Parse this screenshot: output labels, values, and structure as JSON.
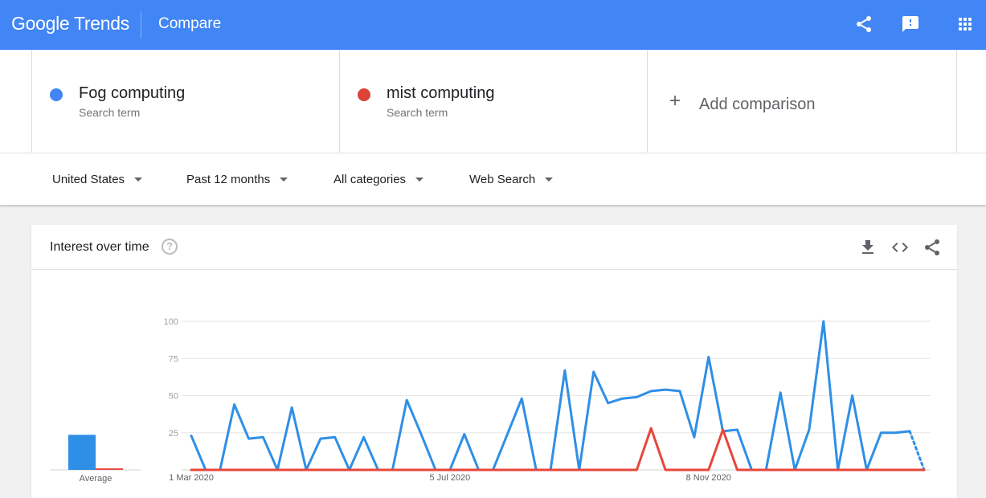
{
  "header": {
    "logo": "Google Trends",
    "page_label": "Compare",
    "icons": [
      "share-icon",
      "feedback-icon",
      "apps-icon"
    ]
  },
  "terms": [
    {
      "name": "Fog computing",
      "sub": "Search term",
      "color": "#4285f4"
    },
    {
      "name": "mist computing",
      "sub": "Search term",
      "color": "#db4437"
    }
  ],
  "add_comparison": {
    "label": "Add comparison"
  },
  "filters": {
    "region": "United States",
    "time": "Past 12 months",
    "category": "All categories",
    "property": "Web Search"
  },
  "card": {
    "title": "Interest over time",
    "help": "?",
    "icons": [
      "download-icon",
      "embed-icon",
      "share-icon"
    ]
  },
  "chart_data": {
    "type": "line",
    "ylim": [
      0,
      100
    ],
    "yticks": [
      "100",
      "75",
      "50",
      "25"
    ],
    "xtick_labels": [
      "1 Mar 2020",
      "5 Jul 2020",
      "8 Nov 2020"
    ],
    "xtick_index": [
      0,
      18,
      36
    ],
    "average_label": "Average",
    "averages": [
      23,
      1
    ],
    "series": [
      {
        "name": "Fog computing",
        "color": "#2f8fe6",
        "values": [
          23,
          0,
          0,
          44,
          21,
          22,
          0,
          42,
          0,
          21,
          22,
          0,
          22,
          0,
          0,
          47,
          24,
          0,
          0,
          24,
          0,
          0,
          24,
          48,
          0,
          0,
          67,
          0,
          66,
          45,
          48,
          49,
          53,
          54,
          53,
          22,
          76,
          26,
          27,
          0,
          0,
          52,
          0,
          27,
          100,
          0,
          50,
          0,
          25,
          25,
          26,
          0
        ],
        "partial_from": 50
      },
      {
        "name": "mist computing",
        "color": "#e8463b",
        "values": [
          0,
          0,
          0,
          0,
          0,
          0,
          0,
          0,
          0,
          0,
          0,
          0,
          0,
          0,
          0,
          0,
          0,
          0,
          0,
          0,
          0,
          0,
          0,
          0,
          0,
          0,
          0,
          0,
          0,
          0,
          0,
          0,
          28,
          0,
          0,
          0,
          0,
          27,
          0,
          0,
          0,
          0,
          0,
          0,
          0,
          0,
          0,
          0,
          0,
          0,
          0,
          0
        ]
      }
    ]
  }
}
